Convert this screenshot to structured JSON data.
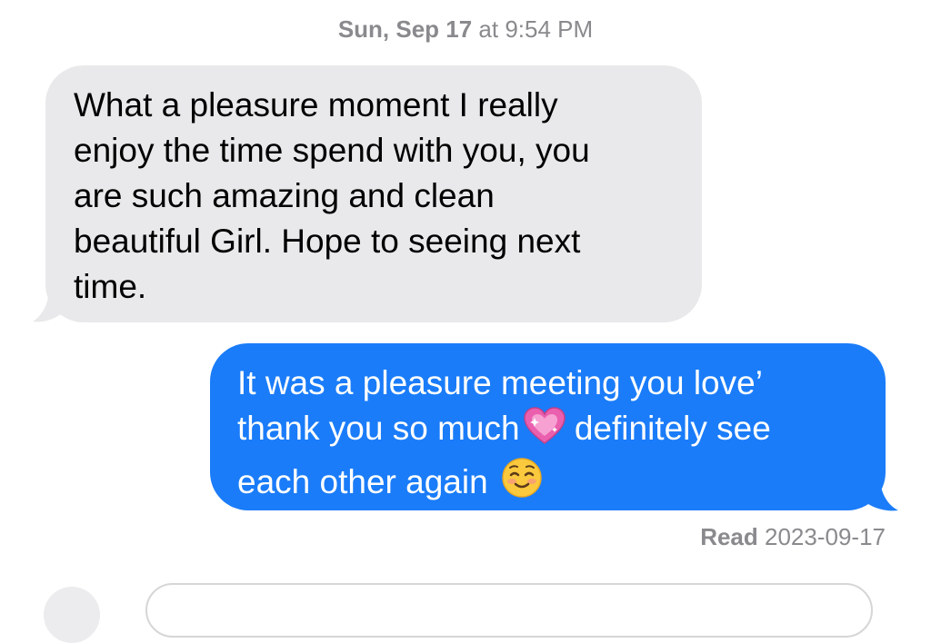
{
  "conversation": {
    "timestamp_day": "Sun, Sep 17",
    "timestamp_time": " at 9:54 PM",
    "messages": [
      {
        "direction": "incoming",
        "text": "What a pleasure moment I really\nenjoy the time spend with you, you\nare such amazing and clean\nbeautiful Girl. Hope to seeing next\ntime."
      },
      {
        "direction": "outgoing",
        "line1": "It was a pleasure meeting you love’",
        "line2a": "thank you so much",
        "line2b": " definitely see",
        "line3": "each other again",
        "emoji1": "sparkling-heart",
        "emoji2": "smiling-face"
      }
    ],
    "read_label": "Read",
    "read_date": " 2023-09-17"
  },
  "colors": {
    "incoming_bubble": "#e9e9eb",
    "outgoing_bubble": "#1a7cf9",
    "meta_text": "#8a8a8e"
  }
}
